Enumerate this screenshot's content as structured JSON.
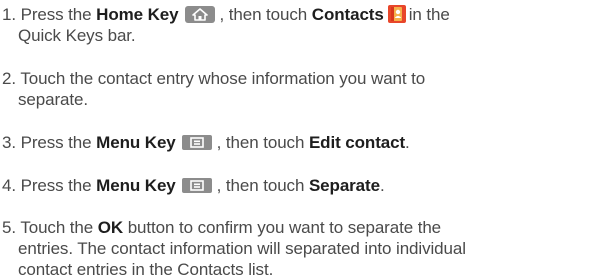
{
  "steps": [
    {
      "number": "1.",
      "press": "Press the",
      "key": "Home Key",
      "mid": ", then touch",
      "target": "Contacts",
      "tail": "in the",
      "cont": "Quick Keys bar.",
      "key_icon": "home-key-icon",
      "app_icon": "contacts-app-icon"
    },
    {
      "number": "2.",
      "line1": "Touch the contact entry whose information you want to",
      "line2": "separate."
    },
    {
      "number": "3.",
      "press": "Press the",
      "key": "Menu Key",
      "mid": ", then touch",
      "target": "Edit contact",
      "end": ".",
      "key_icon": "menu-key-icon"
    },
    {
      "number": "4.",
      "press": "Press the",
      "key": "Menu Key",
      "mid": ", then touch",
      "target": "Separate",
      "end": ".",
      "key_icon": "menu-key-icon"
    },
    {
      "number": "5.",
      "pre": "Touch the",
      "button": "OK",
      "post": "button to confirm you want to separate the",
      "line2": "entries. The contact information will separated into individual",
      "line3": "contact entries in the Contacts list."
    }
  ],
  "colors": {
    "text": "#4a4a4a",
    "emphasis": "#1e1e1e",
    "key_background": "#8c8c8c",
    "contacts_icon": "#e8462a"
  }
}
